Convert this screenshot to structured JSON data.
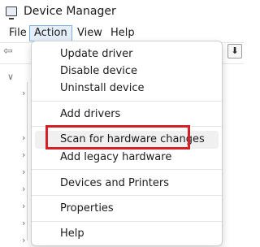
{
  "window": {
    "title": "Device Manager",
    "icon": "device-manager-icon"
  },
  "menubar": {
    "items": [
      {
        "label": "File"
      },
      {
        "label": "Action",
        "active": true
      },
      {
        "label": "View"
      },
      {
        "label": "Help"
      }
    ]
  },
  "action_menu": {
    "items": [
      {
        "label": "Update driver"
      },
      {
        "label": "Disable device"
      },
      {
        "label": "Uninstall device"
      },
      {
        "label": "Add drivers"
      },
      {
        "label": "Scan for hardware changes",
        "highlighted": true
      },
      {
        "label": "Add legacy hardware"
      },
      {
        "label": "Devices and Printers"
      },
      {
        "label": "Properties"
      },
      {
        "label": "Help"
      }
    ]
  },
  "colors": {
    "highlight_border": "#d42027",
    "menu_active_bg": "#e4eef8",
    "menu_active_border": "#7fb0de"
  }
}
